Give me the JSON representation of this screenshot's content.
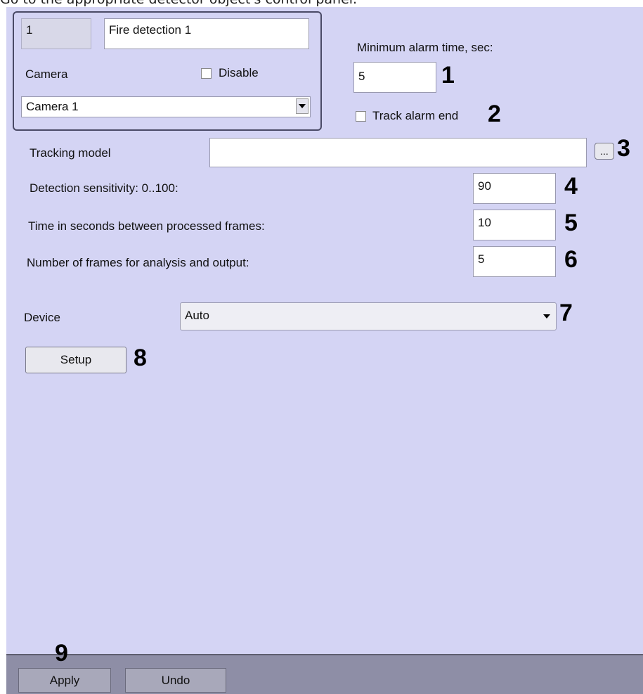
{
  "caption": "Go to the appropriate detector object's control panel.",
  "object": {
    "id": "1",
    "name": "Fire detection 1"
  },
  "camera": {
    "label": "Camera",
    "disable_label": "Disable",
    "selected": "Camera 1"
  },
  "min_alarm": {
    "label": "Minimum alarm time, sec:",
    "value": "5"
  },
  "track_alarm_end": {
    "label": "Track alarm end",
    "checked": false
  },
  "tracking_model": {
    "label": "Tracking model",
    "value": "",
    "browse_label": "..."
  },
  "sensitivity": {
    "label": "Detection sensitivity: 0..100:",
    "value": "90"
  },
  "time_between": {
    "label": "Time in seconds between processed frames:",
    "value": "10"
  },
  "num_frames": {
    "label": "Number of frames for analysis and output:",
    "value": "5"
  },
  "device": {
    "label": "Device",
    "selected": "Auto"
  },
  "setup_button": "Setup",
  "footer": {
    "apply": "Apply",
    "undo": "Undo"
  },
  "callouts": [
    "1",
    "2",
    "3",
    "4",
    "5",
    "6",
    "7",
    "8",
    "9"
  ]
}
